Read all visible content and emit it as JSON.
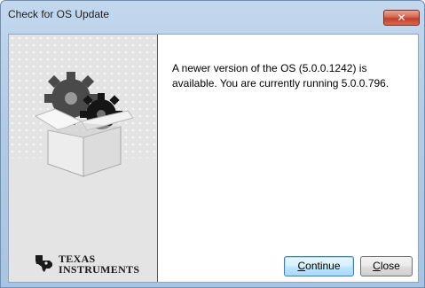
{
  "window": {
    "title": "Check for OS Update",
    "close_icon": "close-icon"
  },
  "branding": {
    "logo_line1": "TEXAS",
    "logo_line2": "INSTRUMENTS",
    "emblem_icon": "texas-state-icon",
    "illustration_icon": "gears-box-icon"
  },
  "message": {
    "text": "A newer version of the OS (5.0.0.1242) is available. You are currently running 5.0.0.796."
  },
  "buttons": {
    "continue_accel": "C",
    "continue_rest": "ontinue",
    "close_accel": "C",
    "close_rest": "lose"
  },
  "colors": {
    "title_bar": "#b3cbe6",
    "close_button": "#c0402a",
    "default_button_border": "#3c7fb1",
    "side_panel": "#e4e4e4"
  }
}
